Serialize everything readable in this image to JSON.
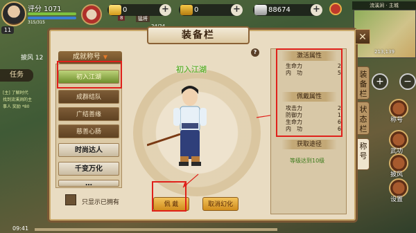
{
  "hud": {
    "score": "评分 1071",
    "level": "11",
    "hp_text": "315/315",
    "tags": [
      "8",
      "猛将"
    ],
    "small": "24/24",
    "currencies": [
      {
        "icon": "gold-coin-icon",
        "value": "0"
      },
      {
        "icon": "gold-ingot-icon",
        "value": "0"
      },
      {
        "icon": "silver-ingot-icon",
        "value": "88674"
      }
    ],
    "map_title": "流溪涧 · 主城",
    "map_coord": "213,139",
    "left_label": "披风 12",
    "task_tab": "任务",
    "task_text": "[主] 了解时代 找到流溪涧的主事人 奖励 *80",
    "time": "09:41",
    "side_icons": [
      {
        "icon": "title-icon",
        "label": "称号"
      },
      {
        "icon": "wuxia-icon",
        "label": "武功"
      },
      {
        "icon": "cape-icon",
        "label": "披风"
      },
      {
        "icon": "settings-icon",
        "label": "设置"
      }
    ],
    "plus_label": "+",
    "minus_label": "−"
  },
  "panel": {
    "title": "装备栏",
    "close": "✕",
    "help": "?",
    "tabs": [
      "装备栏",
      "状态栏",
      "称号"
    ],
    "list_header": "成就称号",
    "list_items": [
      "初入江湖",
      "成群结队",
      "广结善缘",
      "慈善心肠",
      "时尚达人",
      "千变万化",
      "…"
    ],
    "show_owned_label": "只显示已拥有",
    "character_title": "初入江湖",
    "equip_button": "佩 戴",
    "cancel_button": "取消幻化"
  },
  "attributes": {
    "active_title": "激活属性",
    "active": [
      {
        "name": "生命力",
        "value": "2"
      },
      {
        "name": "内　功",
        "value": "5"
      }
    ],
    "wear_title": "佩戴属性",
    "wear": [
      {
        "name": "攻击力",
        "value": "2"
      },
      {
        "name": "防御力",
        "value": "1"
      },
      {
        "name": "生命力",
        "value": "6"
      },
      {
        "name": "内　功",
        "value": "6"
      }
    ],
    "obtain_title": "获取途径",
    "obtain_text": "等级达到10级"
  },
  "colors": {
    "panel_bg": "#e9dcc2",
    "panel_border": "#7a5733",
    "selected_item": "#8db244",
    "annotation_red": "#e0201a",
    "button_gold": "#e6a63a"
  }
}
